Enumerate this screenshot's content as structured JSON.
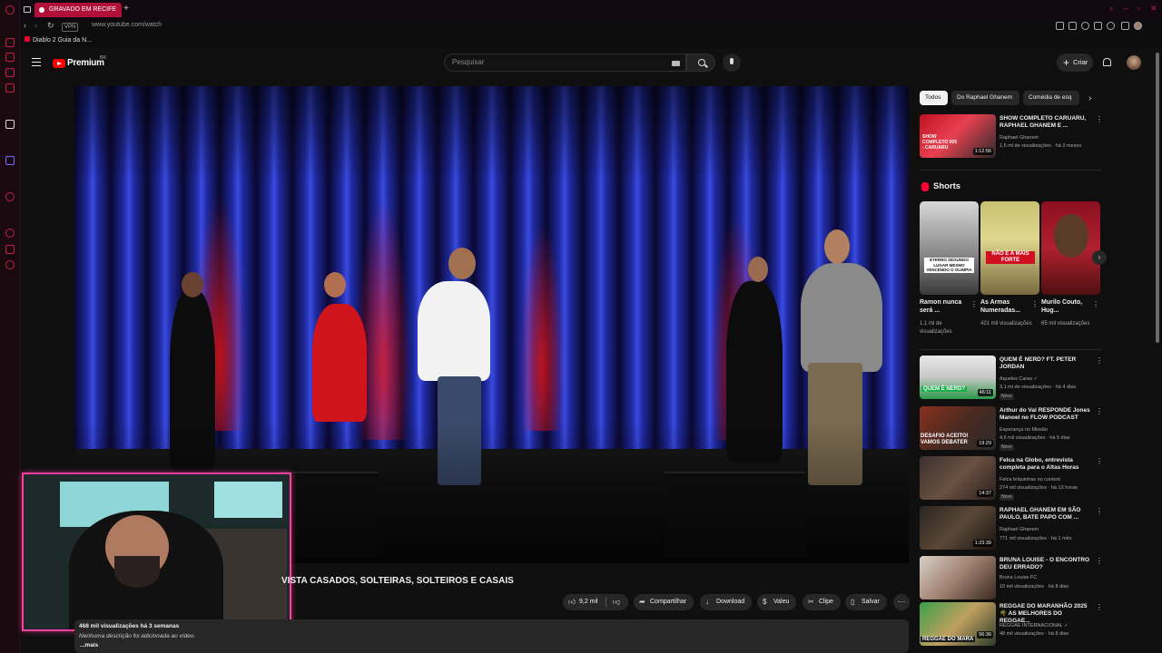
{
  "browser": {
    "tab_title": "GRAVADO EM RECIFE",
    "new_tab": "+",
    "url": "www.youtube.com/watch",
    "vpn": "VPN",
    "bookmark": "Diablo 2 Guia da N..."
  },
  "masthead": {
    "logo_text": "Premium",
    "region": "BR",
    "search_placeholder": "Pesquisar",
    "create_label": "Criar",
    "create_plus": "+"
  },
  "video": {
    "title": "VISTA CASADOS, SOLTEIRAS, SOLTEIROS E CASAIS",
    "likes": "9,2 mil",
    "share_label": "Compartilhar",
    "download_label": "Download",
    "thanks_label": "Valeu",
    "clip_label": "Clipe",
    "save_label": "Salvar",
    "more": "···",
    "views_meta": "468 mil visualizações  há 3 semanas",
    "description": "Nenhuma descrição foi adicionada ao vídeo.",
    "more_link": "...mais"
  },
  "chips": [
    "Todos",
    "Do Raphael Ghanem",
    "Comédia de esq"
  ],
  "chip_next": "›",
  "related_top": {
    "title": "SHOW COMPLETO CARUARU, RAPHAEL GHANEM E ...",
    "channel": "Raphael Ghanem",
    "meta": "1,5 mi de visualizações · há 3 meses",
    "duration": "1:12:56",
    "thumb_text": "SHOW COMPLETO 005 - CARUARU"
  },
  "shorts": {
    "heading": "Shorts",
    "next": "›",
    "items": [
      {
        "title": "Ramon nunca será ...",
        "views": "1,1 mi de visualizações",
        "thumb_text": "ETERNO SEGUNDO LUGAR MESMO VENCENDO O OLIMPIA"
      },
      {
        "title": "As Armas Numeradas...",
        "views": "421 mil visualizações",
        "thumb_text": "NÃO É A MAIS FORTE"
      },
      {
        "title": "Murilo Couto, Hug...",
        "views": "65 mil visualizações",
        "thumb_text": ""
      }
    ]
  },
  "related": [
    {
      "title": "QUEM É NERD? FT. PETER JORDAN",
      "channel": "Aqueles Caras ✓",
      "meta": "3,1 mi de visualizações · há 4 dias",
      "badge": "Novo",
      "duration": "46:11",
      "thumb_text": "QUEM É NERD?"
    },
    {
      "title": "Arthur do Val RESPONDE Jones Manoel no FLOW PODCAST",
      "channel": "Esperança no Missão",
      "meta": "4,6 mil visualizações · há 5 dias",
      "badge": "Novo",
      "duration": "19:29",
      "thumb_text": "DESAFIO ACEITO! VAMOS DEBATER"
    },
    {
      "title": "Felca na Globo, entrevista completa para o Altas Horas",
      "channel": "Felca felquinhas no context",
      "meta": "274 mil visualizações · há 13 horas",
      "badge": "Novo",
      "duration": "14:37",
      "thumb_text": ""
    },
    {
      "title": "RAPHAEL GHANEM EM SÃO PAULO, BATE PAPO COM ...",
      "channel": "Raphael Ghanem",
      "meta": "771 mil visualizações · há 1 mês",
      "badge": "",
      "duration": "1:23:39",
      "thumb_text": ""
    },
    {
      "title": "BRUNA LOUISE - O ENCONTRO DEU ERRADO?",
      "channel": "Bruna Louise FC",
      "meta": "10 mil visualizações · há 8 dias",
      "badge": "",
      "duration": "",
      "thumb_text": ""
    },
    {
      "title": "REGGAE DO MARANHÃO 2025 🌴 AS MELHORES DO REGGAE...",
      "channel": "REGGAE INTERNACIONAL ✓",
      "meta": "48 mil visualizações · há 8 dias",
      "badge": "",
      "duration": "56:36",
      "thumb_text": "REGGAE DO MARA"
    }
  ],
  "colors": {
    "accent": "#ff0000",
    "webcam_border": "#ff3fa0",
    "opera": "#c0204a"
  }
}
